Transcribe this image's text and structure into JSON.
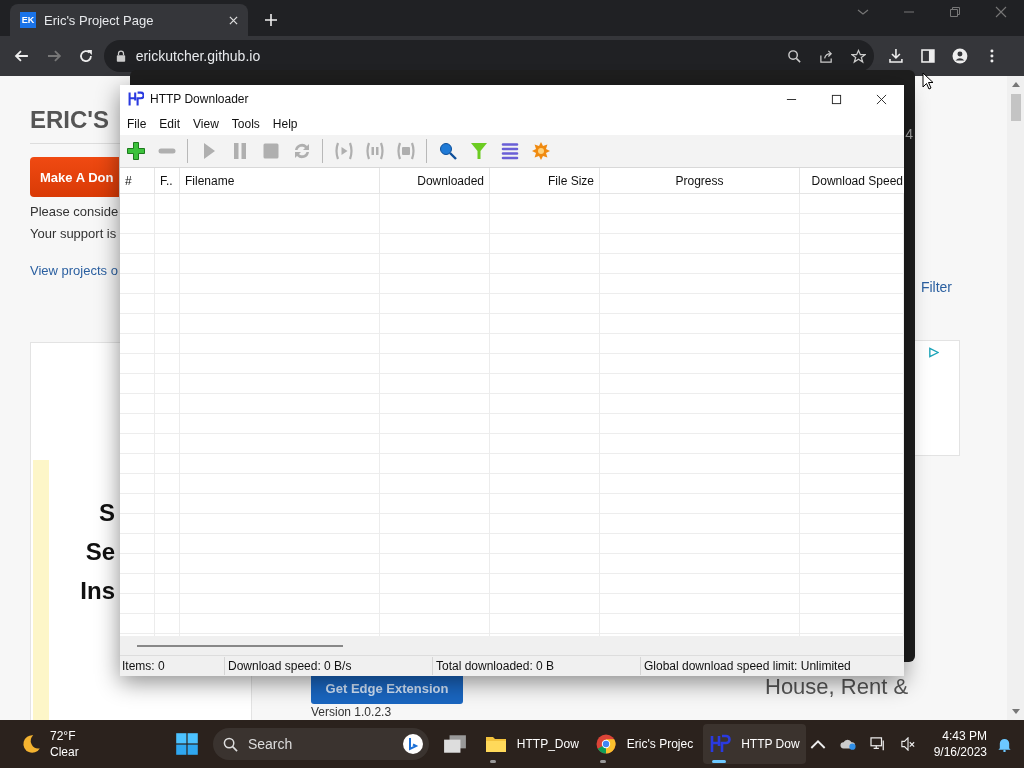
{
  "browser": {
    "tab": {
      "favicon": "EK",
      "title": "Eric's Project Page",
      "selected": true
    },
    "address": "erickutcher.github.io"
  },
  "page": {
    "heading": "ERIC'S",
    "donate_button": "Make A Don",
    "lines": [
      "Please conside",
      "Your support is"
    ],
    "link": "View projects o",
    "ad_headline": [
      "S",
      "Se",
      "Ins"
    ],
    "filter_link": "Filter",
    "extension_button": "Get Edge Extension",
    "version": "Version 1.0.2.3",
    "ad_text": "House, Rent &"
  },
  "back_window": {
    "text": "4"
  },
  "app": {
    "title": "HTTP Downloader",
    "menu": [
      "File",
      "Edit",
      "View",
      "Tools",
      "Help"
    ],
    "toolbar": [
      {
        "kind": "add",
        "disabled": false
      },
      {
        "kind": "remove",
        "disabled": true
      },
      {
        "kind": "separator"
      },
      {
        "kind": "start",
        "disabled": true
      },
      {
        "kind": "pause",
        "disabled": true
      },
      {
        "kind": "stop",
        "disabled": true
      },
      {
        "kind": "restart",
        "disabled": true
      },
      {
        "kind": "separator"
      },
      {
        "kind": "start-all",
        "disabled": true
      },
      {
        "kind": "pause-all",
        "disabled": true
      },
      {
        "kind": "stop-all",
        "disabled": true
      },
      {
        "kind": "separator"
      },
      {
        "kind": "search",
        "disabled": false
      },
      {
        "kind": "filter",
        "disabled": false
      },
      {
        "kind": "list",
        "disabled": false
      },
      {
        "kind": "options",
        "disabled": false
      }
    ],
    "columns": [
      "#",
      "F..",
      "Filename",
      "Downloaded",
      "File Size",
      "Progress",
      "Download Speed"
    ],
    "status_bar": [
      "Items: 0",
      "Download speed: 0 B/s",
      "Total downloaded: 0 B",
      "Global download speed limit: Unlimited"
    ]
  },
  "taskbar": {
    "weather": {
      "temperature": "72°F",
      "condition": "Clear"
    },
    "search": "Search",
    "apps": [
      {
        "kind": "folder",
        "label": "HTTP_Dow",
        "selected": false
      },
      {
        "kind": "browser",
        "label": "Eric's Projec",
        "selected": false
      },
      {
        "kind": "downloader",
        "label": "HTTP Dow",
        "selected": true
      }
    ],
    "time": "4:43 PM",
    "date": "9/16/2023"
  }
}
